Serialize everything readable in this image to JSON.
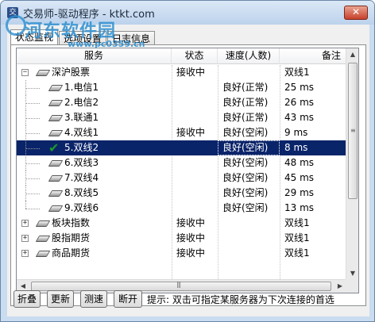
{
  "window": {
    "title": "交易师-驱动程序 - ktkt.com",
    "close_label": "✕"
  },
  "watermark": {
    "text": "河东软件园",
    "url": "www.pc0359.cn"
  },
  "tabs": [
    {
      "label": "状态监视",
      "active": true
    },
    {
      "label": "选项设置",
      "active": false
    },
    {
      "label": "日志信息",
      "active": false
    }
  ],
  "columns": [
    "服务",
    "状态",
    "速度(人数)",
    "备注"
  ],
  "rows": [
    {
      "label": "深沪股票",
      "level": 0,
      "expander": "−",
      "status": "接收中",
      "speed": "",
      "note": "双线1"
    },
    {
      "label": "1.电信1",
      "level": 1,
      "status": "",
      "speed": "良好(正常)",
      "note": "25 ms"
    },
    {
      "label": "2.电信2",
      "level": 1,
      "status": "",
      "speed": "良好(正常)",
      "note": "26 ms"
    },
    {
      "label": "3.联通1",
      "level": 1,
      "status": "",
      "speed": "良好(正常)",
      "note": "43 ms"
    },
    {
      "label": "4.双线1",
      "level": 1,
      "status": "接收中",
      "speed": "良好(空闲)",
      "note": "9 ms"
    },
    {
      "label": "5.双线2",
      "level": 1,
      "status": "",
      "speed": "良好(空闲)",
      "note": "8 ms",
      "selected": true,
      "checked": true
    },
    {
      "label": "6.双线3",
      "level": 1,
      "status": "",
      "speed": "良好(空闲)",
      "note": "48 ms"
    },
    {
      "label": "7.双线4",
      "level": 1,
      "status": "",
      "speed": "良好(空闲)",
      "note": "45 ms"
    },
    {
      "label": "8.双线5",
      "level": 1,
      "status": "",
      "speed": "良好(空闲)",
      "note": "29 ms"
    },
    {
      "label": "9.双线6",
      "level": 1,
      "status": "",
      "speed": "良好(空闲)",
      "note": "13 ms"
    },
    {
      "label": "板块指数",
      "level": 0,
      "expander": "+",
      "status": "接收中",
      "speed": "",
      "note": "双线1"
    },
    {
      "label": "股指期货",
      "level": 0,
      "expander": "+",
      "status": "接收中",
      "speed": "",
      "note": "双线1"
    },
    {
      "label": "商品期货",
      "level": 0,
      "expander": "+",
      "status": "接收中",
      "speed": "",
      "note": "双线1"
    }
  ],
  "buttons": [
    "折叠",
    "更新",
    "测速",
    "断开"
  ],
  "tip": "提示: 双击可指定某服务器为下次连接的首选",
  "colors": {
    "selection": "#0a246a",
    "accent": "#2d8fd0",
    "check": "#1d9a2b"
  },
  "icons": {
    "node": "server-node-icon",
    "check": "checkmark-icon"
  }
}
